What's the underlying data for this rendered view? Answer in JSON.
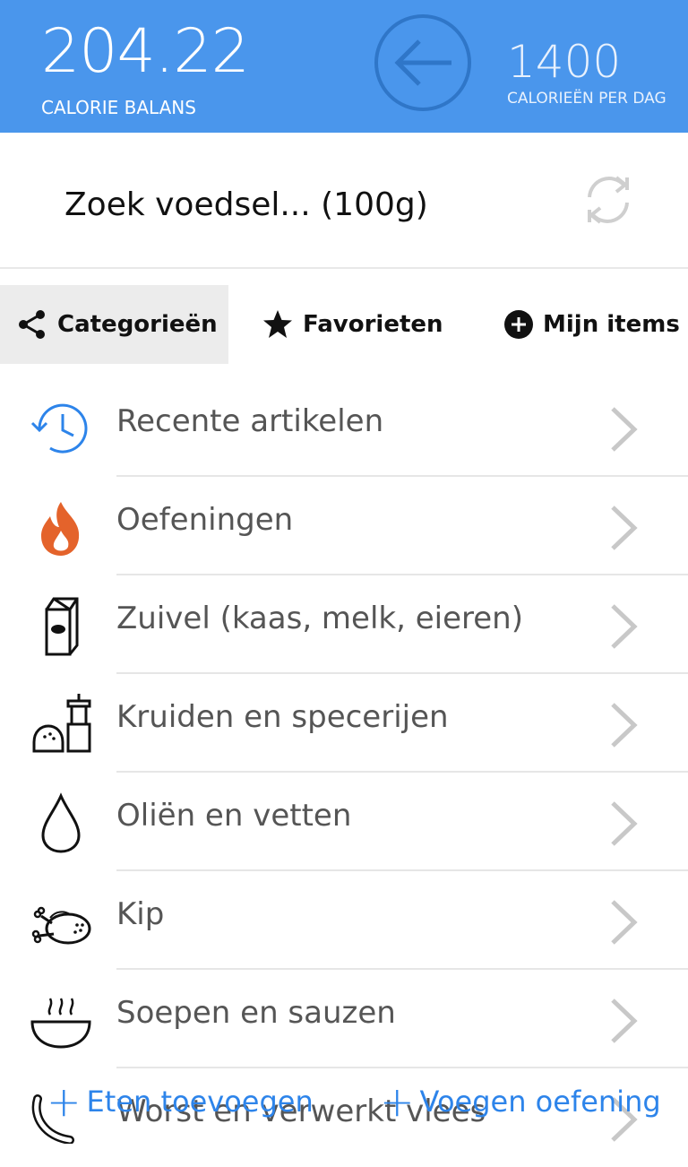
{
  "header": {
    "balance_value": "204.22",
    "balance_label": "CALORIE BALANS",
    "per_day_value": "1400",
    "per_day_label": "CALORIEËN PER DAG",
    "back_icon": "arrow-left-circle-icon",
    "color": "#4a96ec"
  },
  "search": {
    "text": "Zoek voedsel... (100g)",
    "refresh_icon": "refresh-icon"
  },
  "tabs": [
    {
      "label": "Categorieën",
      "icon": "share-icon",
      "active": true
    },
    {
      "label": "Favorieten",
      "icon": "star-icon",
      "active": false
    },
    {
      "label": "Mijn items",
      "icon": "plus-circle-icon",
      "active": false
    }
  ],
  "categories": [
    {
      "label": "Recente artikelen",
      "icon": "history-icon"
    },
    {
      "label": "Oefeningen",
      "icon": "fire-icon"
    },
    {
      "label": "Zuivel (kaas, melk, eieren)",
      "icon": "milk-carton-icon"
    },
    {
      "label": "Kruiden en specerijen",
      "icon": "salt-pepper-icon"
    },
    {
      "label": "Oliën en vetten",
      "icon": "drop-icon"
    },
    {
      "label": "Kip",
      "icon": "chicken-icon"
    },
    {
      "label": "Soepen en sauzen",
      "icon": "soup-bowl-icon"
    },
    {
      "label": "Worst en verwerkt vlees",
      "icon": "sausage-icon"
    }
  ],
  "actions": {
    "add_food": "Eten toevoegen",
    "add_exercise": "Voegen oefening",
    "plus": "+",
    "color": "#2d84ea"
  }
}
